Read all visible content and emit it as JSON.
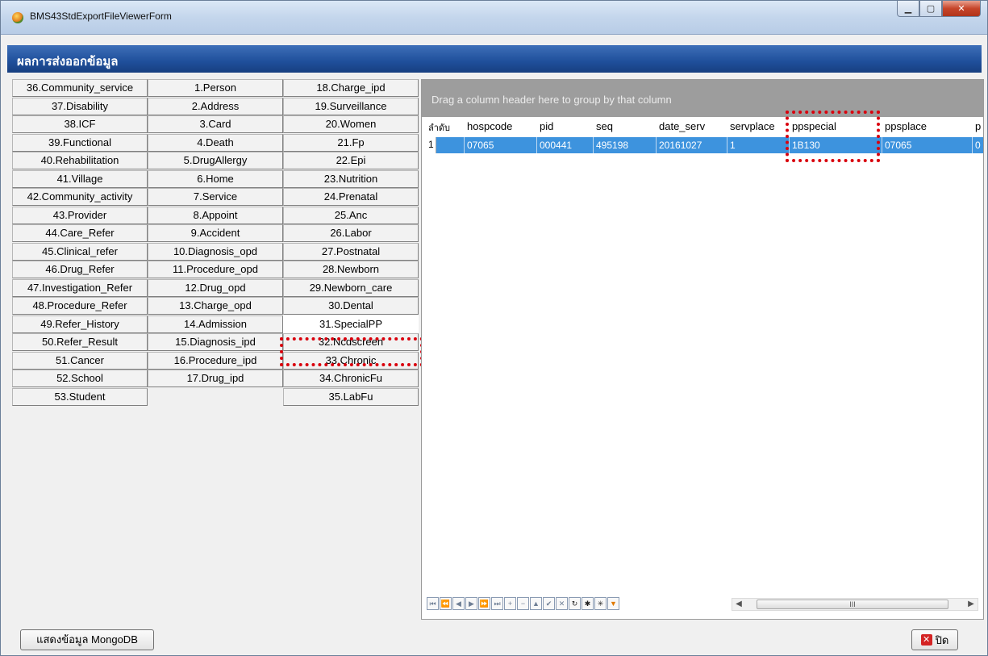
{
  "window": {
    "title": "BMS43StdExportFileViewerForm",
    "minimize_glyph": "▁",
    "maximize_glyph": "▢",
    "close_glyph": "✕"
  },
  "header": {
    "title": "ผลการส่งออกข้อมูล"
  },
  "tabs": {
    "col1": [
      "36.Community_service",
      "37.Disability",
      "38.ICF",
      "39.Functional",
      "40.Rehabilitation",
      "41.Village",
      "42.Community_activity",
      "43.Provider",
      "44.Care_Refer",
      "45.Clinical_refer",
      "46.Drug_Refer",
      "47.Investigation_Refer",
      "48.Procedure_Refer",
      "49.Refer_History",
      "50.Refer_Result",
      "51.Cancer",
      "52.School",
      "53.Student"
    ],
    "col2": [
      "1.Person",
      "2.Address",
      "3.Card",
      "4.Death",
      "5.DrugAllergy",
      "6.Home",
      "7.Service",
      "8.Appoint",
      "9.Accident",
      "10.Diagnosis_opd",
      "11.Procedure_opd",
      "12.Drug_opd",
      "13.Charge_opd",
      "14.Admission",
      "15.Diagnosis_ipd",
      "16.Procedure_ipd",
      "17.Drug_ipd"
    ],
    "col3": [
      "18.Charge_ipd",
      "19.Surveillance",
      "20.Women",
      "21.Fp",
      "22.Epi",
      "23.Nutrition",
      "24.Prenatal",
      "25.Anc",
      "26.Labor",
      "27.Postnatal",
      "28.Newborn",
      "29.Newborn_care",
      "30.Dental",
      "31.SpecialPP",
      "32.Ncdscreen",
      "33.Chronic",
      "34.ChronicFu",
      "35.LabFu"
    ],
    "active": "31.SpecialPP"
  },
  "grid": {
    "group_hint": "Drag a column header here to group by that column",
    "columns": [
      "ลำดับ",
      "hospcode",
      "pid",
      "seq",
      "date_serv",
      "servplace",
      "ppspecial",
      "ppsplace",
      "p"
    ],
    "rows": [
      [
        "1",
        "07065",
        "000441",
        "495198",
        "20161027",
        "1",
        "1B130",
        "07065",
        "0"
      ]
    ],
    "highlighted_column": "ppspecial"
  },
  "navigator": {
    "buttons": [
      "⏮",
      "⏪",
      "◀",
      "▶",
      "⏩",
      "⏭",
      "+",
      "−",
      "▲",
      "✔",
      "✕",
      "↻",
      "✱",
      "✳",
      "▼"
    ]
  },
  "scrollbar": {
    "left_arrow": "◀",
    "right_arrow": "▶",
    "thumb_grip": "III"
  },
  "footer": {
    "mongo_button": "แสดงข้อมูล MongoDB",
    "close_button": "ปิด",
    "close_icon": "✕"
  },
  "colors": {
    "header_blue": "#1f4f9b",
    "selection_blue": "#3d93de",
    "highlight_red": "#d9000d"
  }
}
